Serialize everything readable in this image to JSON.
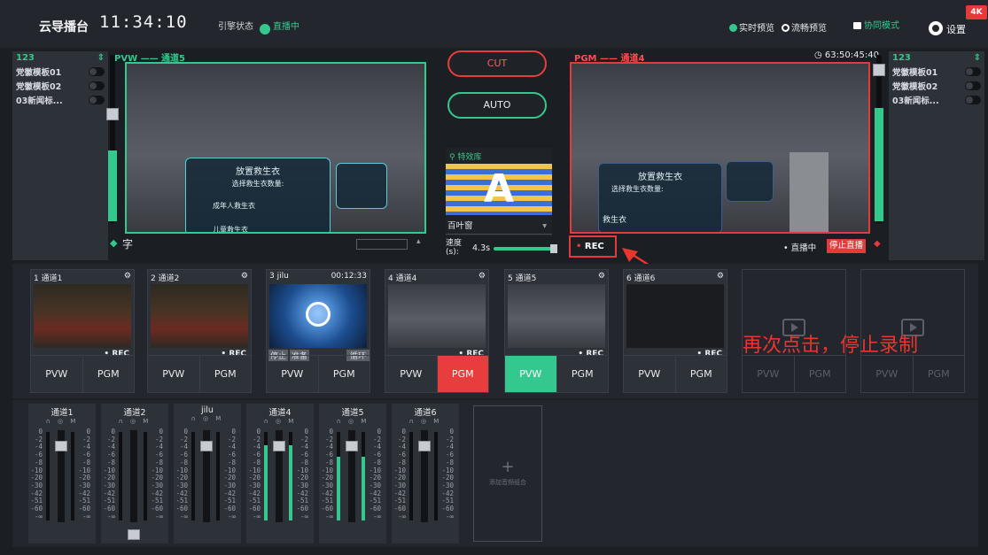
{
  "app": {
    "title": "云导播台",
    "clock": "11:34:10",
    "engine_label": "引擎状态",
    "engine_status": "直播中",
    "badge": "4K"
  },
  "topbar": {
    "preview_realtime": "实时预览",
    "preview_smooth": "流畅预览",
    "collab_mode": "协同模式",
    "settings": "设置"
  },
  "left_list": {
    "header": "123",
    "items": [
      {
        "label": "党徽模板01"
      },
      {
        "label": "党徽模板02"
      },
      {
        "label": "03新闻标..."
      }
    ]
  },
  "right_list": {
    "header": "123",
    "items": [
      {
        "label": "党徽模板01"
      },
      {
        "label": "党徽模板02"
      },
      {
        "label": "03新闻标..."
      }
    ]
  },
  "pvw": {
    "label": "PVW —— 通道5",
    "text_tool": "字"
  },
  "pgm": {
    "label": "PGM —— 通道4",
    "timer": "63:50:45:40",
    "rec": "REC",
    "live": "直播中",
    "stop_live": "停止直播"
  },
  "scene_text": {
    "title": "放置救生衣",
    "subtitle": "选择救生衣数量:",
    "row1": "成年人救生衣",
    "row2": "儿童救生衣",
    "pgm_row": "救生衣"
  },
  "center": {
    "cut": "CUT",
    "auto": "AUTO",
    "effect_lib": "特效库",
    "effect_name": "百叶窗",
    "speed_label": "速度(s):",
    "speed_value": "4.3s"
  },
  "sources": [
    {
      "title": "1 通道1",
      "rec": "REC",
      "pvw": "PVW",
      "pgm": "PGM",
      "state": "none"
    },
    {
      "title": "2 通道2",
      "rec": "REC",
      "pvw": "PVW",
      "pgm": "PGM",
      "state": "none"
    },
    {
      "title": "3 jilu",
      "time": "00:12:33",
      "rec": "REC",
      "pvw": "PVW",
      "pgm": "PGM",
      "state": "none",
      "controls": [
        "停止",
        "准备",
        "循环"
      ]
    },
    {
      "title": "4 通道4",
      "rec": "REC",
      "pvw": "PVW",
      "pgm": "PGM",
      "state": "pgm"
    },
    {
      "title": "5 通道5",
      "rec": "REC",
      "pvw": "PVW",
      "pgm": "PGM",
      "state": "pvw"
    },
    {
      "title": "6 通道6",
      "rec": "REC",
      "pvw": "PVW",
      "pgm": "PGM",
      "state": "none"
    },
    {
      "title": "",
      "pvw": "PVW",
      "pgm": "PGM",
      "state": "empty"
    },
    {
      "title": "",
      "pvw": "PVW",
      "pgm": "PGM",
      "state": "empty"
    }
  ],
  "mixer": {
    "strips": [
      {
        "name": "通道1",
        "level": 0
      },
      {
        "name": "通道2",
        "level": 0
      },
      {
        "name": "jilu",
        "level": 0
      },
      {
        "name": "通道4",
        "level": 0.85
      },
      {
        "name": "通道5",
        "level": 0.72
      },
      {
        "name": "通道6",
        "level": 0
      }
    ],
    "scale": [
      "0",
      "-2",
      "-4",
      "-6",
      "-8",
      "-10",
      "-20",
      "-30",
      "-42",
      "-51",
      "-60",
      "-∞"
    ],
    "add_label": "添加音频组合",
    "icons": "∩ ◎ M"
  },
  "annotation": "再次点击，停止录制",
  "colors": {
    "accent": "#35c88e",
    "red": "#e63a3a",
    "bg": "#1b1e23"
  }
}
